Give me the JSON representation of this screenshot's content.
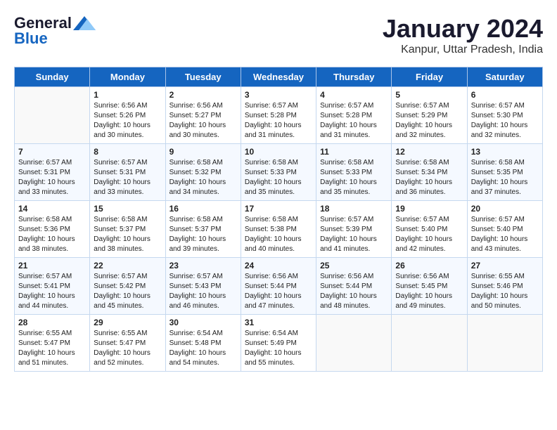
{
  "header": {
    "logo_line1": "General",
    "logo_line2": "Blue",
    "month": "January 2024",
    "location": "Kanpur, Uttar Pradesh, India"
  },
  "weekdays": [
    "Sunday",
    "Monday",
    "Tuesday",
    "Wednesday",
    "Thursday",
    "Friday",
    "Saturday"
  ],
  "weeks": [
    [
      {
        "day": "",
        "info": ""
      },
      {
        "day": "1",
        "info": "Sunrise: 6:56 AM\nSunset: 5:26 PM\nDaylight: 10 hours\nand 30 minutes."
      },
      {
        "day": "2",
        "info": "Sunrise: 6:56 AM\nSunset: 5:27 PM\nDaylight: 10 hours\nand 30 minutes."
      },
      {
        "day": "3",
        "info": "Sunrise: 6:57 AM\nSunset: 5:28 PM\nDaylight: 10 hours\nand 31 minutes."
      },
      {
        "day": "4",
        "info": "Sunrise: 6:57 AM\nSunset: 5:28 PM\nDaylight: 10 hours\nand 31 minutes."
      },
      {
        "day": "5",
        "info": "Sunrise: 6:57 AM\nSunset: 5:29 PM\nDaylight: 10 hours\nand 32 minutes."
      },
      {
        "day": "6",
        "info": "Sunrise: 6:57 AM\nSunset: 5:30 PM\nDaylight: 10 hours\nand 32 minutes."
      }
    ],
    [
      {
        "day": "7",
        "info": "Sunrise: 6:57 AM\nSunset: 5:31 PM\nDaylight: 10 hours\nand 33 minutes."
      },
      {
        "day": "8",
        "info": "Sunrise: 6:57 AM\nSunset: 5:31 PM\nDaylight: 10 hours\nand 33 minutes."
      },
      {
        "day": "9",
        "info": "Sunrise: 6:58 AM\nSunset: 5:32 PM\nDaylight: 10 hours\nand 34 minutes."
      },
      {
        "day": "10",
        "info": "Sunrise: 6:58 AM\nSunset: 5:33 PM\nDaylight: 10 hours\nand 35 minutes."
      },
      {
        "day": "11",
        "info": "Sunrise: 6:58 AM\nSunset: 5:33 PM\nDaylight: 10 hours\nand 35 minutes."
      },
      {
        "day": "12",
        "info": "Sunrise: 6:58 AM\nSunset: 5:34 PM\nDaylight: 10 hours\nand 36 minutes."
      },
      {
        "day": "13",
        "info": "Sunrise: 6:58 AM\nSunset: 5:35 PM\nDaylight: 10 hours\nand 37 minutes."
      }
    ],
    [
      {
        "day": "14",
        "info": "Sunrise: 6:58 AM\nSunset: 5:36 PM\nDaylight: 10 hours\nand 38 minutes."
      },
      {
        "day": "15",
        "info": "Sunrise: 6:58 AM\nSunset: 5:37 PM\nDaylight: 10 hours\nand 38 minutes."
      },
      {
        "day": "16",
        "info": "Sunrise: 6:58 AM\nSunset: 5:37 PM\nDaylight: 10 hours\nand 39 minutes."
      },
      {
        "day": "17",
        "info": "Sunrise: 6:58 AM\nSunset: 5:38 PM\nDaylight: 10 hours\nand 40 minutes."
      },
      {
        "day": "18",
        "info": "Sunrise: 6:57 AM\nSunset: 5:39 PM\nDaylight: 10 hours\nand 41 minutes."
      },
      {
        "day": "19",
        "info": "Sunrise: 6:57 AM\nSunset: 5:40 PM\nDaylight: 10 hours\nand 42 minutes."
      },
      {
        "day": "20",
        "info": "Sunrise: 6:57 AM\nSunset: 5:40 PM\nDaylight: 10 hours\nand 43 minutes."
      }
    ],
    [
      {
        "day": "21",
        "info": "Sunrise: 6:57 AM\nSunset: 5:41 PM\nDaylight: 10 hours\nand 44 minutes."
      },
      {
        "day": "22",
        "info": "Sunrise: 6:57 AM\nSunset: 5:42 PM\nDaylight: 10 hours\nand 45 minutes."
      },
      {
        "day": "23",
        "info": "Sunrise: 6:57 AM\nSunset: 5:43 PM\nDaylight: 10 hours\nand 46 minutes."
      },
      {
        "day": "24",
        "info": "Sunrise: 6:56 AM\nSunset: 5:44 PM\nDaylight: 10 hours\nand 47 minutes."
      },
      {
        "day": "25",
        "info": "Sunrise: 6:56 AM\nSunset: 5:44 PM\nDaylight: 10 hours\nand 48 minutes."
      },
      {
        "day": "26",
        "info": "Sunrise: 6:56 AM\nSunset: 5:45 PM\nDaylight: 10 hours\nand 49 minutes."
      },
      {
        "day": "27",
        "info": "Sunrise: 6:55 AM\nSunset: 5:46 PM\nDaylight: 10 hours\nand 50 minutes."
      }
    ],
    [
      {
        "day": "28",
        "info": "Sunrise: 6:55 AM\nSunset: 5:47 PM\nDaylight: 10 hours\nand 51 minutes."
      },
      {
        "day": "29",
        "info": "Sunrise: 6:55 AM\nSunset: 5:47 PM\nDaylight: 10 hours\nand 52 minutes."
      },
      {
        "day": "30",
        "info": "Sunrise: 6:54 AM\nSunset: 5:48 PM\nDaylight: 10 hours\nand 54 minutes."
      },
      {
        "day": "31",
        "info": "Sunrise: 6:54 AM\nSunset: 5:49 PM\nDaylight: 10 hours\nand 55 minutes."
      },
      {
        "day": "",
        "info": ""
      },
      {
        "day": "",
        "info": ""
      },
      {
        "day": "",
        "info": ""
      }
    ]
  ]
}
